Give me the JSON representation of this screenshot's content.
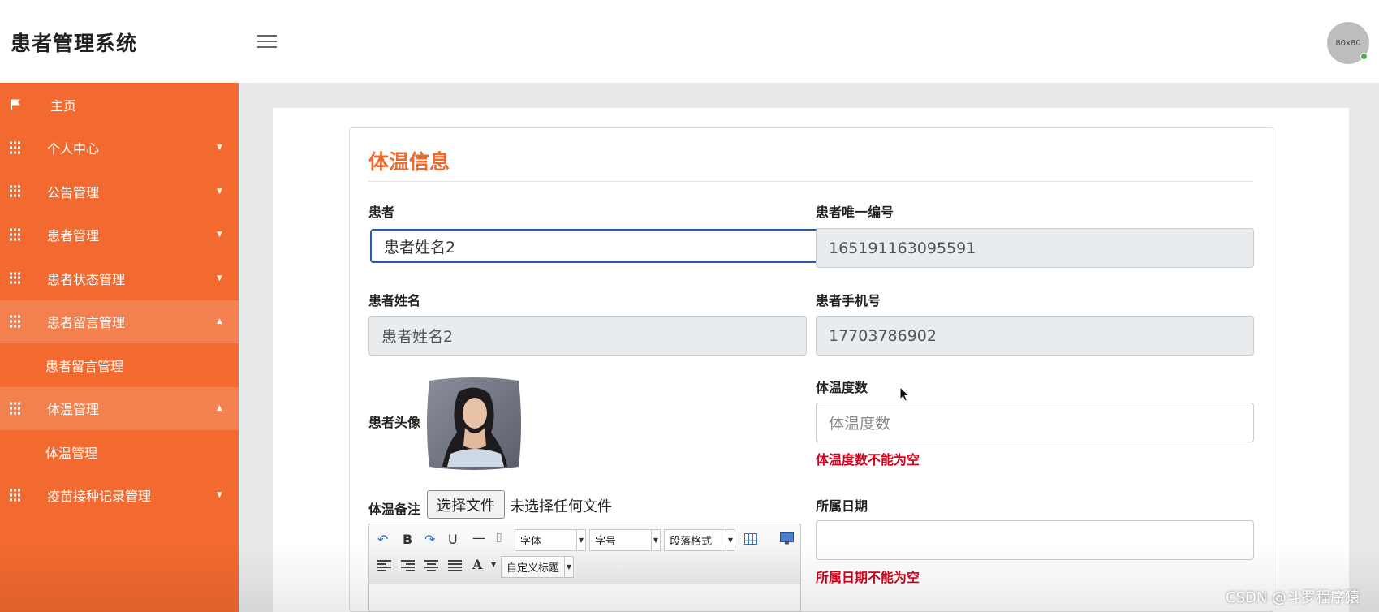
{
  "header": {
    "app_title": "患者管理系统",
    "avatar_text": "80x80"
  },
  "sidebar": {
    "items": [
      {
        "label": "主页"
      },
      {
        "label": "个人中心"
      },
      {
        "label": "公告管理"
      },
      {
        "label": "患者管理"
      },
      {
        "label": "患者状态管理"
      },
      {
        "label": "患者留言管理",
        "sub": "患者留言管理"
      },
      {
        "label": "体温管理",
        "sub": "体温管理"
      },
      {
        "label": "疫苗接种记录管理"
      }
    ]
  },
  "form": {
    "title": "体温信息",
    "patient_label": "患者",
    "patient_value": "患者姓名2",
    "patient_id_label": "患者唯一编号",
    "patient_id_value": "165191163095591",
    "patient_name_label": "患者姓名",
    "patient_name_value": "患者姓名2",
    "patient_phone_label": "患者手机号",
    "patient_phone_value": "17703786902",
    "avatar_label": "患者头像",
    "temperature_label": "体温度数",
    "temperature_placeholder": "体温度数",
    "temperature_error": "体温度数不能为空",
    "remark_label": "体温备注",
    "file_button": "选择文件",
    "file_status": "未选择任何文件",
    "date_label": "所属日期",
    "date_value": "",
    "date_error": "所属日期不能为空"
  },
  "editor": {
    "font_family": "字体",
    "font_size": "字号",
    "paragraph": "段落格式",
    "custom_title": "自定义标题"
  },
  "watermark": "CSDN @斗罗程序猿",
  "colors": {
    "sidebar_bg": "#f26a2f",
    "sidebar_open": "#f3804f",
    "accent_title": "#ec6a2c",
    "error": "#d0011b",
    "focus_border": "#1f5fa8"
  }
}
